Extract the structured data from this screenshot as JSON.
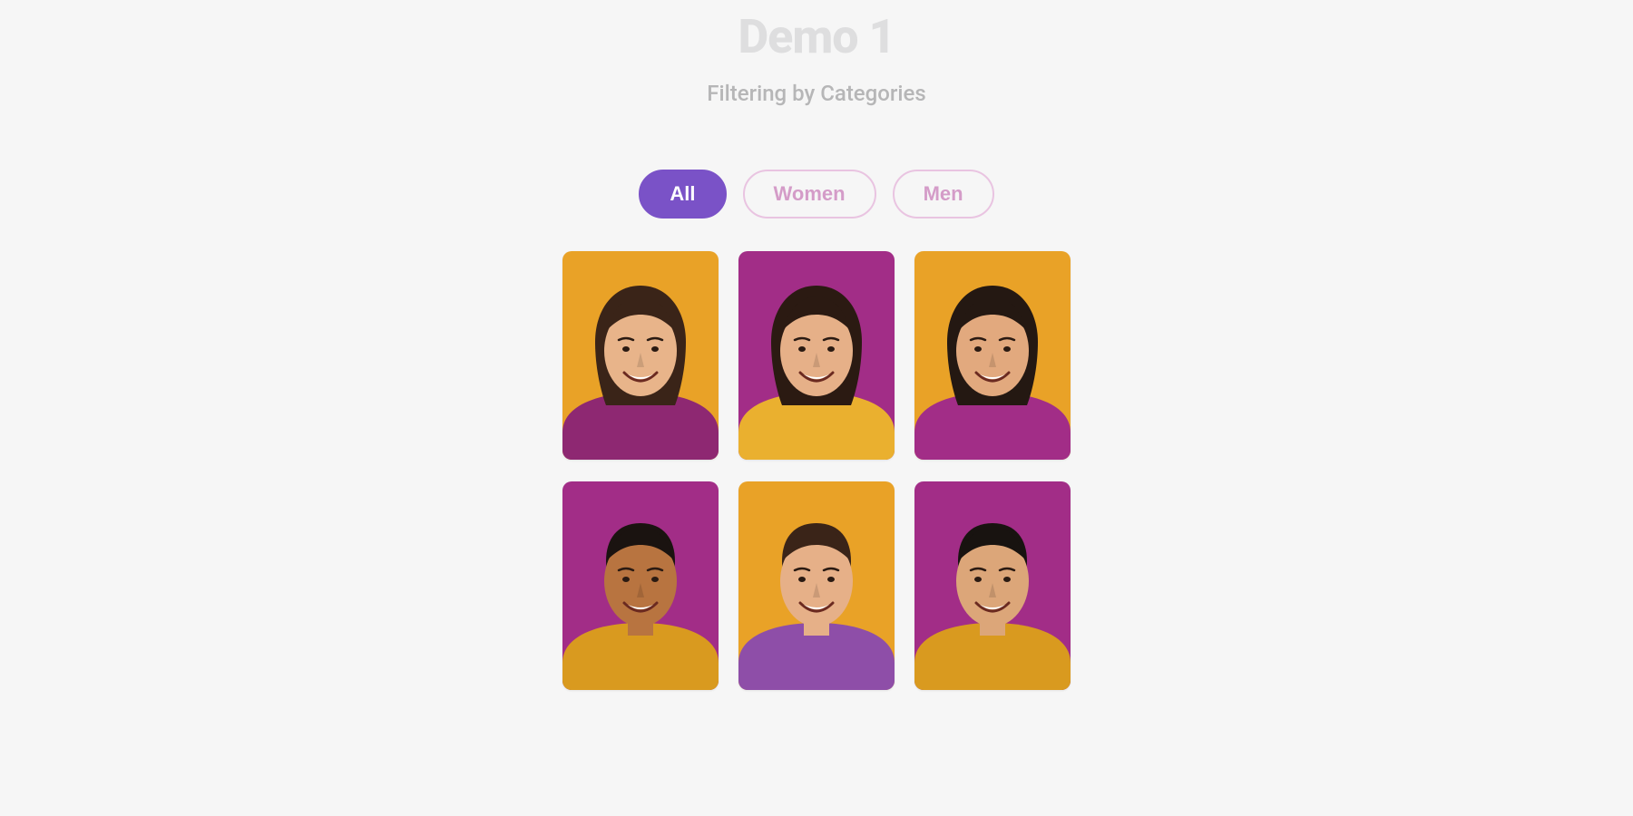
{
  "header": {
    "title": "Demo 1",
    "subtitle": "Filtering by Categories"
  },
  "filters": {
    "items": [
      {
        "label": "All",
        "active": true
      },
      {
        "label": "Women",
        "active": false
      },
      {
        "label": "Men",
        "active": false
      }
    ]
  },
  "palette": {
    "accent": "#7a52c7",
    "pill_border": "#e9c4e1",
    "pill_text": "#d49cc8",
    "bg_orange": "#e9a227",
    "bg_magenta": "#a22d87",
    "shirt_magenta": "#8e2872",
    "shirt_orange": "#eab02f",
    "shirt_purple": "#8e4ea8",
    "shirt_mustard": "#d99a1f"
  },
  "grid": {
    "items": [
      {
        "name": "portrait-woman-1",
        "bg": "#e9a227",
        "shirt": "#8e2872",
        "hair": "#3a2418",
        "skin": "#e8b48a"
      },
      {
        "name": "portrait-woman-2",
        "bg": "#a22d87",
        "shirt": "#eab02f",
        "hair": "#2b1a12",
        "skin": "#e6b088"
      },
      {
        "name": "portrait-woman-3",
        "bg": "#e9a227",
        "shirt": "#a22d87",
        "hair": "#241812",
        "skin": "#e2a97e"
      },
      {
        "name": "portrait-man-1",
        "bg": "#a22d87",
        "shirt": "#d99a1f",
        "hair": "#1a1310",
        "skin": "#b87440"
      },
      {
        "name": "portrait-man-2",
        "bg": "#e9a227",
        "shirt": "#8e4ea8",
        "hair": "#3a2418",
        "skin": "#e6b088"
      },
      {
        "name": "portrait-man-3",
        "bg": "#a22d87",
        "shirt": "#d99a1f",
        "hair": "#181310",
        "skin": "#dca679"
      }
    ]
  }
}
